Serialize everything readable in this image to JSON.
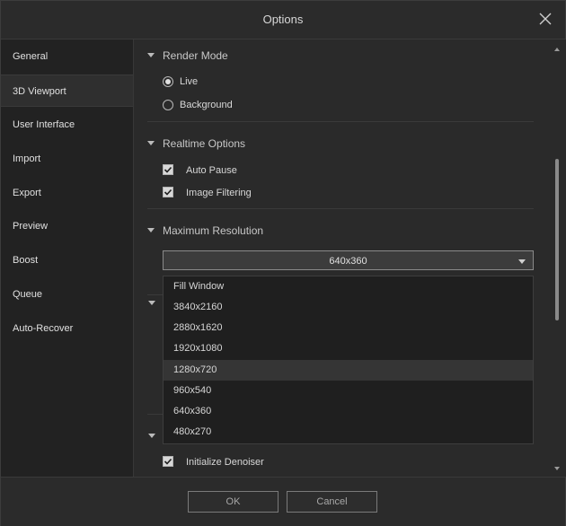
{
  "window": {
    "title": "Options"
  },
  "sidebar": {
    "items": [
      {
        "label": "General"
      },
      {
        "label": "3D Viewport"
      },
      {
        "label": "User Interface"
      },
      {
        "label": "Import"
      },
      {
        "label": "Export"
      },
      {
        "label": "Preview"
      },
      {
        "label": "Boost"
      },
      {
        "label": "Queue"
      },
      {
        "label": "Auto-Recover"
      }
    ],
    "active": "3D Viewport"
  },
  "render_mode": {
    "header": "Render Mode",
    "options": [
      {
        "label": "Live",
        "selected": true
      },
      {
        "label": "Background",
        "selected": false
      }
    ]
  },
  "realtime": {
    "header": "Realtime Options",
    "auto_pause": {
      "label": "Auto Pause",
      "checked": true
    },
    "image_filtering": {
      "label": "Image Filtering",
      "checked": true
    }
  },
  "resolution": {
    "header": "Maximum Resolution",
    "selected": "640x360",
    "options": [
      "Fill Window",
      "3840x2160",
      "2880x1620",
      "1920x1080",
      "1280x720",
      "960x540",
      "640x360",
      "480x270"
    ],
    "highlighted": "1280x720"
  },
  "denoiser": {
    "label": "Initialize Denoiser",
    "checked": true
  },
  "footer": {
    "ok_label": "OK",
    "cancel_label": "Cancel"
  }
}
